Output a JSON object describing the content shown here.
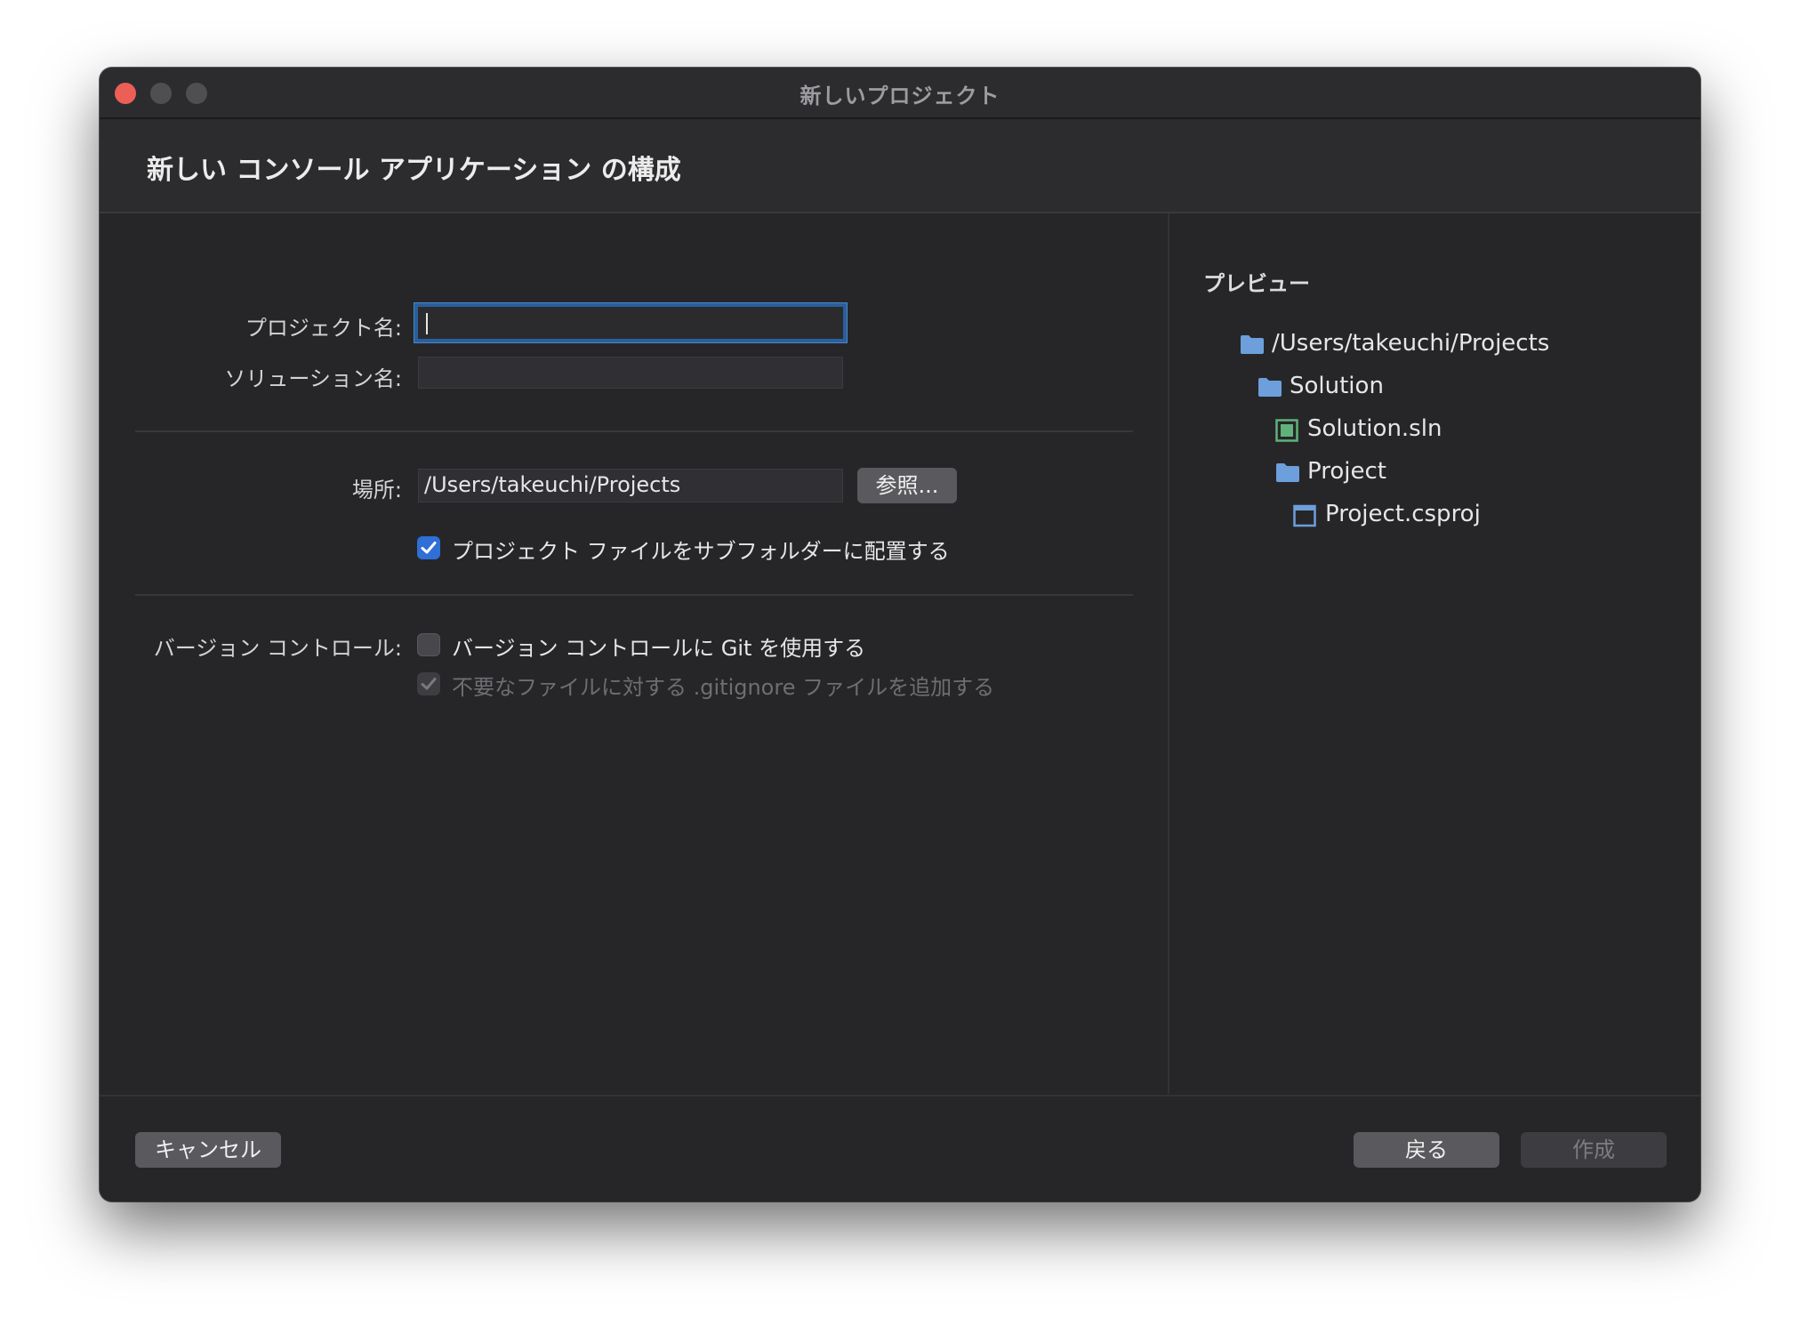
{
  "window": {
    "title": "新しいプロジェクト"
  },
  "header": {
    "title": "新しい コンソール アプリケーション の構成"
  },
  "form": {
    "project_name_label": "プロジェクト名:",
    "project_name_value": "",
    "solution_name_label": "ソリューション名:",
    "solution_name_value": "",
    "location_label": "場所:",
    "location_value": "/Users/takeuchi/Projects",
    "browse_label": "参照...",
    "subfolder_checkbox_label": "プロジェクト ファイルをサブフォルダーに配置する",
    "subfolder_checked": true,
    "vc_label": "バージョン コントロール:",
    "git_checkbox_label": "バージョン コントロールに Git を使用する",
    "git_checked": false,
    "gitignore_checkbox_label": "不要なファイルに対する .gitignore ファイルを追加する",
    "gitignore_checked": true,
    "gitignore_disabled": true
  },
  "preview": {
    "title": "プレビュー",
    "tree": [
      {
        "label": "/Users/takeuchi/Projects",
        "icon": "folder-icon"
      },
      {
        "label": "Solution",
        "icon": "folder-icon"
      },
      {
        "label": "Solution.sln",
        "icon": "solution-file-icon"
      },
      {
        "label": "Project",
        "icon": "folder-icon"
      },
      {
        "label": "Project.csproj",
        "icon": "project-file-icon"
      }
    ]
  },
  "footer": {
    "cancel_label": "キャンセル",
    "back_label": "戻る",
    "create_label": "作成"
  },
  "colors": {
    "accent": "#2f6fd6",
    "folder": "#6d9fdc",
    "solution_icon": "#5fb37a",
    "window_bg": "#262629"
  }
}
